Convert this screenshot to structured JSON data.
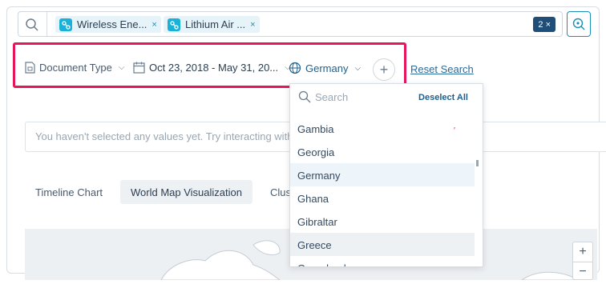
{
  "search": {
    "chips": [
      {
        "label": "Wireless Ene...",
        "remove": "×"
      },
      {
        "label": "Lithium Air ...",
        "remove": "×"
      }
    ],
    "count_badge": "2 ×"
  },
  "filters": {
    "document_type": "Document Type",
    "date_range": "Oct 23, 2018 - May 31, 20...",
    "country": "Germany",
    "add": "+",
    "reset": "Reset Search"
  },
  "notice": "You haven't selected any values yet. Try interacting with the",
  "tabs": [
    {
      "label": "Timeline Chart"
    },
    {
      "label": "World Map Visualization"
    },
    {
      "label": "Clus"
    }
  ],
  "dropdown": {
    "placeholder": "Search",
    "deselect_all": "Deselect All",
    "items": [
      "Gambia",
      "Georgia",
      "Germany",
      "Ghana",
      "Gibraltar",
      "Greece",
      "Greenland"
    ],
    "selected": "Germany"
  },
  "zoom": {
    "in": "+",
    "out": "−"
  },
  "colors": {
    "accent": "#1a8fb8",
    "highlight": "#e5175a",
    "badge": "#1f4e79"
  }
}
